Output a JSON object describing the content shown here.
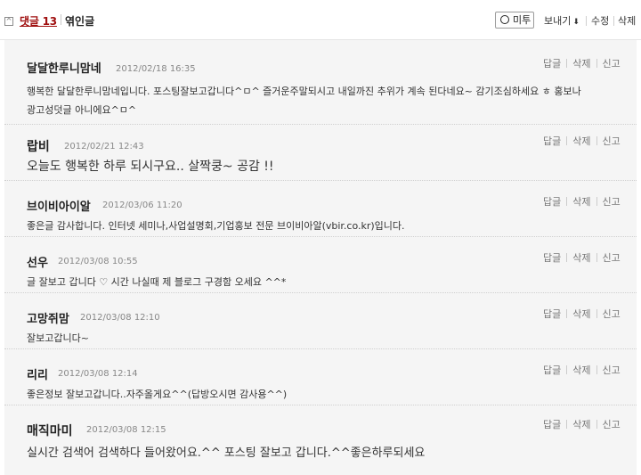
{
  "header": {
    "fold_icon": "collapse-box-icon",
    "comments_label": "댓글 13",
    "linked_label": "엮인글",
    "mitu_label": "미투",
    "export_label": "보내기",
    "edit_label": "수정",
    "delete_label": "삭제"
  },
  "action_labels": {
    "reply": "답글",
    "delete": "삭제",
    "report": "신고"
  },
  "comments": [
    {
      "author": "달달한루니맘네",
      "date": "2012/02/18 16:35",
      "lines": [
        "행복한 달달한루니맘네입니다. 포스팅잘보고갑니다^ㅁ^ 즐거운주말되시고 내일까진 추위가 계속 된다네요~ 감기조심하세요 ㅎ 홍보나",
        "광고성덧글 아니에요^ㅁ^"
      ]
    },
    {
      "author": "랍비",
      "date": "2012/02/21 12:43",
      "lines": [
        "오늘도 행복한 하루 되시구요.. 살짝쿵~ 공감 !!"
      ]
    },
    {
      "author": "브이비아이알",
      "date": "2012/03/06 11:20",
      "lines": [
        "좋은글 감사합니다. 인터넷 세미나,사업설명회,기업홍보 전문 브이비아알(vbir.co.kr)입니다."
      ]
    },
    {
      "author": "선우",
      "date": "2012/03/08 10:55",
      "lines": [
        "글 잘보고 갑니다 ♡ 시간 나실때 제 블로그 구경함 오세요 ^^*"
      ]
    },
    {
      "author": "고망쥐맘",
      "date": "2012/03/08 12:10",
      "lines": [
        "잘보고갑니다~"
      ]
    },
    {
      "author": "리리",
      "date": "2012/03/08 12:14",
      "lines": [
        "좋은정보 잘보고갑니다..자주올게요^^(답방오시면 감사용^^)"
      ]
    },
    {
      "author": "매직마미",
      "date": "2012/03/08 12:15",
      "lines": [
        "실시간 검색어 검색하다 들어왔어요.^^ 포스팅 잘보고 갑니다.^^좋은하루되세요"
      ]
    }
  ]
}
